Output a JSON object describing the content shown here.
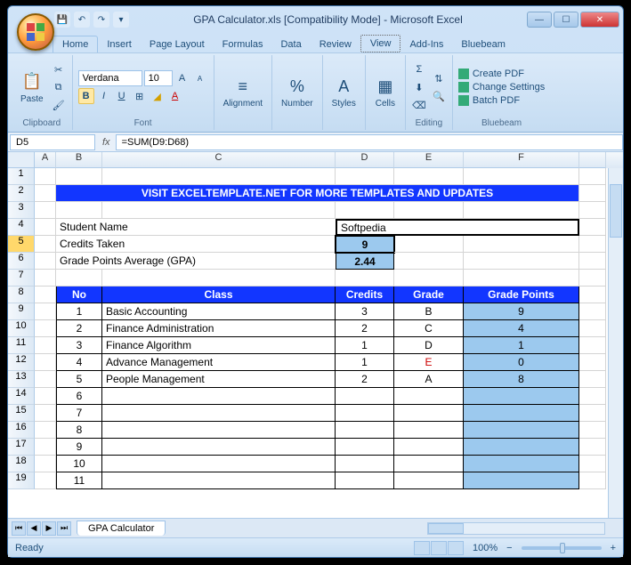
{
  "window": {
    "title": "GPA Calculator.xls  [Compatibility Mode] - Microsoft Excel"
  },
  "tabs": {
    "home": "Home",
    "insert": "Insert",
    "pagelayout": "Page Layout",
    "formulas": "Formulas",
    "data": "Data",
    "review": "Review",
    "view": "View",
    "addins": "Add-Ins",
    "bluebeam": "Bluebeam"
  },
  "ribbon": {
    "clipboard": {
      "paste": "Paste",
      "label": "Clipboard"
    },
    "font": {
      "name": "Verdana",
      "size": "10",
      "label": "Font"
    },
    "alignment": {
      "label": "Alignment"
    },
    "number": {
      "label": "Number"
    },
    "styles": {
      "label": "Styles"
    },
    "cells": {
      "label": "Cells"
    },
    "editing": {
      "label": "Editing"
    },
    "bluebeam": {
      "label": "Bluebeam",
      "createpdf": "Create PDF",
      "changesettings": "Change Settings",
      "batchpdf": "Batch PDF"
    }
  },
  "namebox": "D5",
  "formula": "=SUM(D9:D68)",
  "columns": [
    "A",
    "B",
    "C",
    "D",
    "E",
    "F"
  ],
  "sheet": {
    "banner": "VISIT EXCELTEMPLATE.NET FOR MORE TEMPLATES AND UPDATES",
    "labels": {
      "student": "Student Name",
      "credits": "Credits Taken",
      "gpa": "Grade Points Average (GPA)"
    },
    "student_name": "Softpedia",
    "credits_taken": "9",
    "gpa": "2.44",
    "headers": {
      "no": "No",
      "class": "Class",
      "credits": "Credits",
      "grade": "Grade",
      "gp": "Grade Points"
    },
    "rows": [
      {
        "no": "1",
        "class": "Basic Accounting",
        "credits": "3",
        "grade": "B",
        "gp": "9"
      },
      {
        "no": "2",
        "class": "Finance Administration",
        "credits": "2",
        "grade": "C",
        "gp": "4"
      },
      {
        "no": "3",
        "class": "Finance Algorithm",
        "credits": "1",
        "grade": "D",
        "gp": "1"
      },
      {
        "no": "4",
        "class": "Advance Management",
        "credits": "1",
        "grade": "E",
        "gp": "0",
        "red": true
      },
      {
        "no": "5",
        "class": "People Management",
        "credits": "2",
        "grade": "A",
        "gp": "8"
      },
      {
        "no": "6"
      },
      {
        "no": "7"
      },
      {
        "no": "8"
      },
      {
        "no": "9"
      },
      {
        "no": "10"
      },
      {
        "no": "11"
      }
    ]
  },
  "sheet_tab": "GPA Calculator",
  "status": {
    "ready": "Ready",
    "zoom": "100%"
  }
}
